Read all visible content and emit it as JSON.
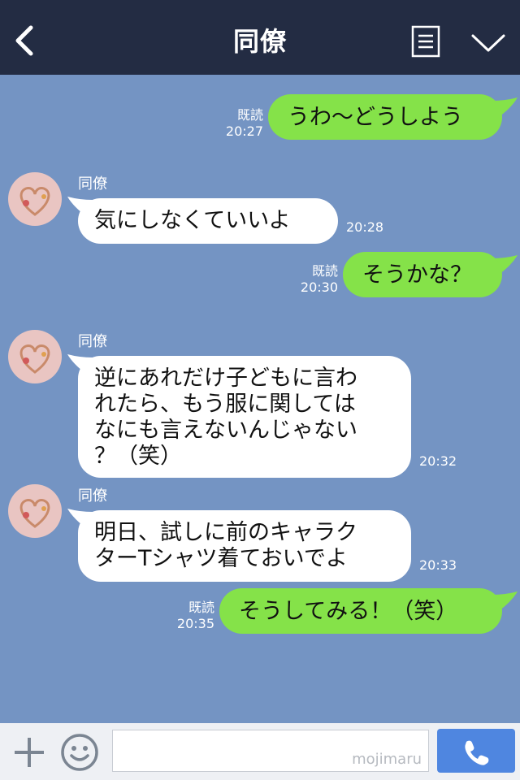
{
  "header": {
    "title": "同僚",
    "back_icon": "chevron-left-icon",
    "menu_icon": "menu-icon",
    "collapse_icon": "chevron-down-icon"
  },
  "messages": [
    {
      "side": "out",
      "text": "うわ〜どうしよう",
      "read": "既読",
      "time": "20:27"
    },
    {
      "side": "in",
      "sender": "同僚",
      "text": "気にしなくていいよ",
      "time": "20:28"
    },
    {
      "side": "out",
      "text": "そうかな？",
      "read": "既読",
      "time": "20:30"
    },
    {
      "side": "in",
      "sender": "同僚",
      "lines": [
        "逆にあれだけ子どもに言わ",
        "れたら、もう服に関しては",
        "なにも言えないんじゃない",
        "？（笑）"
      ],
      "time": "20:32"
    },
    {
      "side": "in",
      "sender": "同僚",
      "lines": [
        "明日、試しに前のキャラク",
        "ターTシャツ着ておいでよ"
      ],
      "time": "20:33"
    },
    {
      "side": "out",
      "text": "そうしてみる！（笑）",
      "read": "既読",
      "time": "20:35"
    }
  ],
  "footer": {
    "plus_icon": "plus-icon",
    "emoji_icon": "smiley-icon",
    "input_value": "",
    "watermark": "mojimaru",
    "call_icon": "phone-icon"
  },
  "colors": {
    "header_bg": "#232c43",
    "chat_bg": "#7494c3",
    "outgoing_bubble": "#85e249",
    "incoming_bubble": "#ffffff",
    "call_button": "#4f86e0"
  }
}
